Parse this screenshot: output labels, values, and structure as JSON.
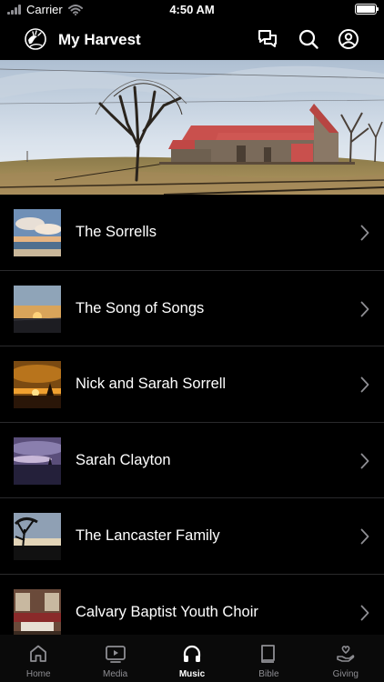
{
  "status_bar": {
    "carrier": "Carrier",
    "time": "4:50 AM",
    "battery_level": 1.0
  },
  "header": {
    "title": "My Harvest",
    "icons": [
      "chat-icon",
      "search-icon",
      "profile-icon"
    ]
  },
  "music": {
    "items": [
      {
        "title": "The Sorrells",
        "thumbnail": "beach-clouds"
      },
      {
        "title": "The Song of Songs",
        "thumbnail": "sunset-horizon"
      },
      {
        "title": "Nick and Sarah Sorrell",
        "thumbnail": "orange-sunset"
      },
      {
        "title": "Sarah Clayton",
        "thumbnail": "purple-dusk"
      },
      {
        "title": "The Lancaster Family",
        "thumbnail": "tree-silhouette"
      },
      {
        "title": "Calvary Baptist Youth Choir",
        "thumbnail": "church-interior"
      }
    ]
  },
  "tabs": [
    {
      "label": "Home",
      "icon": "home-icon",
      "active": false
    },
    {
      "label": "Media",
      "icon": "media-icon",
      "active": false
    },
    {
      "label": "Music",
      "icon": "headphones-icon",
      "active": true
    },
    {
      "label": "Bible",
      "icon": "bible-icon",
      "active": false
    },
    {
      "label": "Giving",
      "icon": "giving-icon",
      "active": false
    }
  ],
  "colors": {
    "background": "#000000",
    "barn_roof": "#c9504d",
    "separator": "#2a2a2c",
    "inactive_tab": "#8e8e93"
  }
}
